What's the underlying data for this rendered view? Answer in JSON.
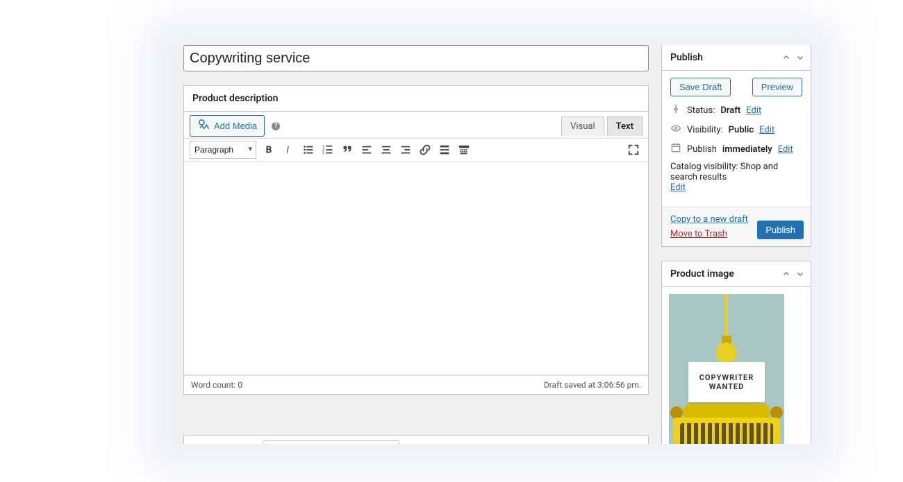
{
  "title_value": "Copywriting service",
  "description_panel": {
    "heading": "Product description",
    "add_media_label": "Add Media",
    "tabs": {
      "visual": "Visual",
      "text": "Text",
      "active": "text"
    },
    "paragraph_select": "Paragraph",
    "word_count_label": "Word count: ",
    "word_count_value": "0",
    "save_status": "Draft saved at 3:06:56 pm."
  },
  "publish": {
    "heading": "Publish",
    "save_draft": "Save Draft",
    "preview": "Preview",
    "status_label": "Status: ",
    "status_value": "Draft",
    "visibility_label": "Visibility: ",
    "visibility_value": "Public",
    "publish_label": "Publish ",
    "publish_value": "immediately",
    "edit": "Edit",
    "catalog_label": "Catalog visibility: ",
    "catalog_value": "Shop and search results",
    "copy_draft": "Copy to a new draft",
    "trash": "Move to Trash",
    "publish_btn": "Publish"
  },
  "product_image": {
    "heading": "Product image",
    "sign_line1": "COPYWRITER",
    "sign_line2": "WANTED"
  }
}
